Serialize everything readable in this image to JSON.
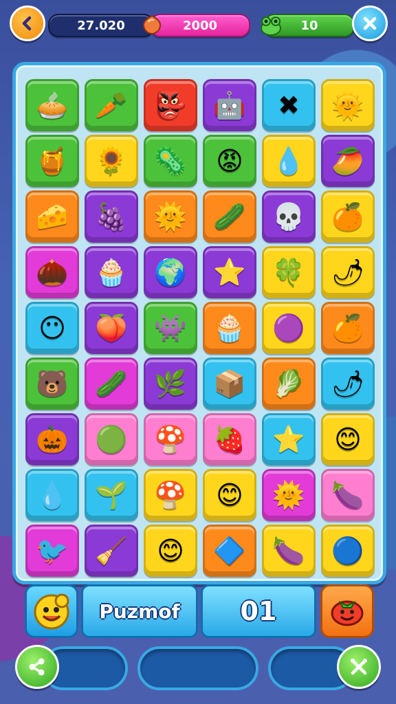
{
  "hud": {
    "back_icon": "left-arrow-icon",
    "coins_value": "27.020",
    "gems_value": "2000",
    "lives_value": "10",
    "close_icon": "close-icon"
  },
  "board": {
    "rows": 9,
    "cols": 6,
    "tiles": [
      [
        "green",
        "pie"
      ],
      [
        "green",
        "carrot"
      ],
      [
        "red",
        "mask"
      ],
      [
        "purple",
        "box-face"
      ],
      [
        "cyan",
        "x-star"
      ],
      [
        "yellow",
        "sun"
      ],
      [
        "green",
        "jar"
      ],
      [
        "yellow",
        "sunflower"
      ],
      [
        "green",
        "blob"
      ],
      [
        "green",
        "red-blob"
      ],
      [
        "yellow",
        "drop"
      ],
      [
        "purple",
        "mango"
      ],
      [
        "orange",
        "cheese"
      ],
      [
        "purple",
        "plum"
      ],
      [
        "orange",
        "sun"
      ],
      [
        "orange",
        "leaf"
      ],
      [
        "purple",
        "skull"
      ],
      [
        "yellow",
        "orange"
      ],
      [
        "magenta",
        "nut"
      ],
      [
        "purple",
        "cupcake"
      ],
      [
        "purple",
        "globe"
      ],
      [
        "purple",
        "star"
      ],
      [
        "yellow",
        "flower"
      ],
      [
        "yellow",
        "chili"
      ],
      [
        "cyan",
        "face"
      ],
      [
        "purple",
        "berry"
      ],
      [
        "green",
        "blob-purple"
      ],
      [
        "orange",
        "cupcake"
      ],
      [
        "yellow",
        "eye"
      ],
      [
        "orange",
        "orange-face"
      ],
      [
        "green",
        "bear"
      ],
      [
        "magenta",
        "leaf"
      ],
      [
        "purple",
        "leaf-dark"
      ],
      [
        "cyan",
        "box"
      ],
      [
        "orange",
        "pea"
      ],
      [
        "cyan",
        "pepper"
      ],
      [
        "purple",
        "pumpkin"
      ],
      [
        "pink",
        "green-face"
      ],
      [
        "pink",
        "mushroom"
      ],
      [
        "pink",
        "strawberry"
      ],
      [
        "cyan",
        "starfish"
      ],
      [
        "yellow",
        "smiley"
      ],
      [
        "cyan",
        "drop"
      ],
      [
        "cyan",
        "plant"
      ],
      [
        "yellow",
        "mushroom"
      ],
      [
        "yellow",
        "smiley"
      ],
      [
        "magenta",
        "sun"
      ],
      [
        "pink",
        "eggplant"
      ],
      [
        "magenta",
        "bird"
      ],
      [
        "purple",
        "broom"
      ],
      [
        "yellow",
        "smiley"
      ],
      [
        "orange",
        "card"
      ],
      [
        "yellow",
        "eggplant"
      ],
      [
        "yellow",
        "blue-face"
      ]
    ]
  },
  "bottom": {
    "title": "Puzmof",
    "score": "01"
  },
  "footer": {
    "left_icon": "share-icon",
    "right_icon": "crossed-tools-icon"
  },
  "colors": {
    "green": "#4cc23a",
    "red": "#f23c2a",
    "purple": "#8b3ad6",
    "cyan": "#33c2ef",
    "yellow": "#ffd61c",
    "orange": "#ff8a1c",
    "magenta": "#e23bd8",
    "pink": "#ff7ed0"
  }
}
